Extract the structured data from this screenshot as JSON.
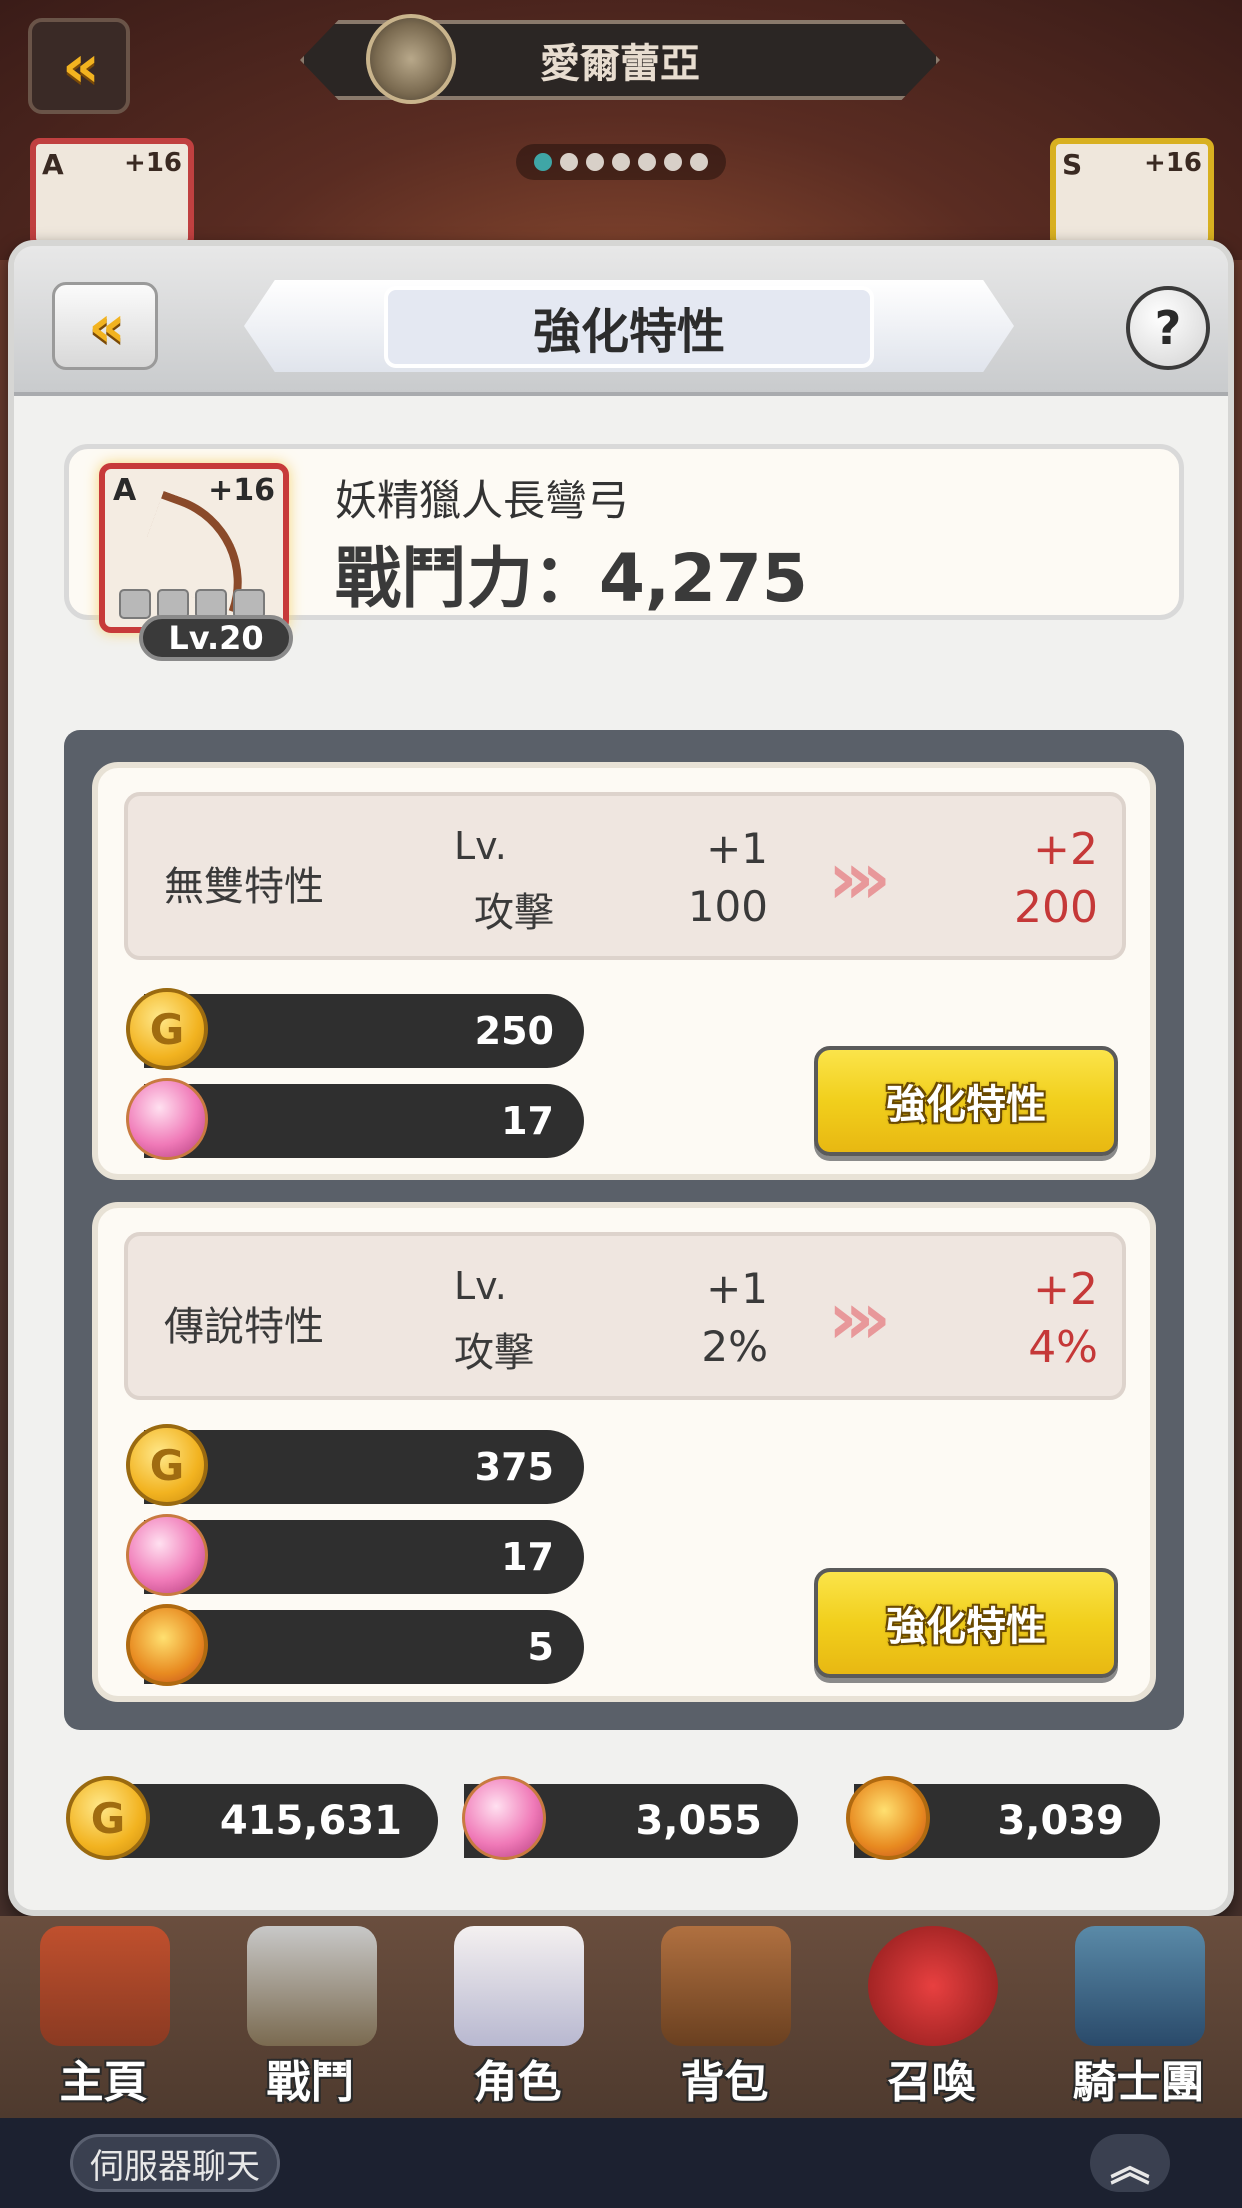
{
  "background": {
    "character_title": "愛爾蕾亞",
    "left_card": {
      "grade": "A",
      "plus": "+16"
    },
    "right_card": {
      "grade": "S",
      "plus": "+16"
    },
    "page_dots": 7,
    "active_dot": 1
  },
  "panel": {
    "title": "強化特性",
    "help_label": "?"
  },
  "item": {
    "grade": "A",
    "plus": "+16",
    "level": "Lv.20",
    "name": "妖精獵人長彎弓",
    "power": "戰鬥力：4,275"
  },
  "traits": [
    {
      "name": "無雙特性",
      "lv_label": "Lv.",
      "stat_label": "攻擊",
      "current_level": "+1",
      "current_value": "100",
      "next_level": "+2",
      "next_value": "200",
      "costs": [
        {
          "icon": "gold-coin-icon",
          "value": "250"
        },
        {
          "icon": "crystal-orb-icon",
          "value": "17"
        }
      ],
      "button_label": "強化特性"
    },
    {
      "name": "傳說特性",
      "lv_label": "Lv.",
      "stat_label": "攻擊",
      "current_level": "+1",
      "current_value": "2%",
      "next_level": "+2",
      "next_value": "4%",
      "costs": [
        {
          "icon": "gold-coin-icon",
          "value": "375"
        },
        {
          "icon": "crystal-orb-icon",
          "value": "17"
        },
        {
          "icon": "medal-icon",
          "value": "5"
        }
      ],
      "button_label": "強化特性"
    }
  ],
  "totals": {
    "gold": "415,631",
    "orbs": "3,055",
    "medals": "3,039"
  },
  "nav": [
    {
      "label": "主頁",
      "icon": "house-icon"
    },
    {
      "label": "戰鬥",
      "icon": "swords-icon"
    },
    {
      "label": "角色",
      "icon": "character-icon"
    },
    {
      "label": "背包",
      "icon": "backpack-icon"
    },
    {
      "label": "召喚",
      "icon": "summon-orb-icon"
    },
    {
      "label": "騎士團",
      "icon": "castle-icon"
    }
  ],
  "chat": {
    "label": "伺服器聊天",
    "expand_icon": "chevron-up-icon"
  },
  "colors": {
    "accent_gold": "#f2b320",
    "increase_red": "#c53838",
    "button_yellow": "#f1cf1c"
  }
}
